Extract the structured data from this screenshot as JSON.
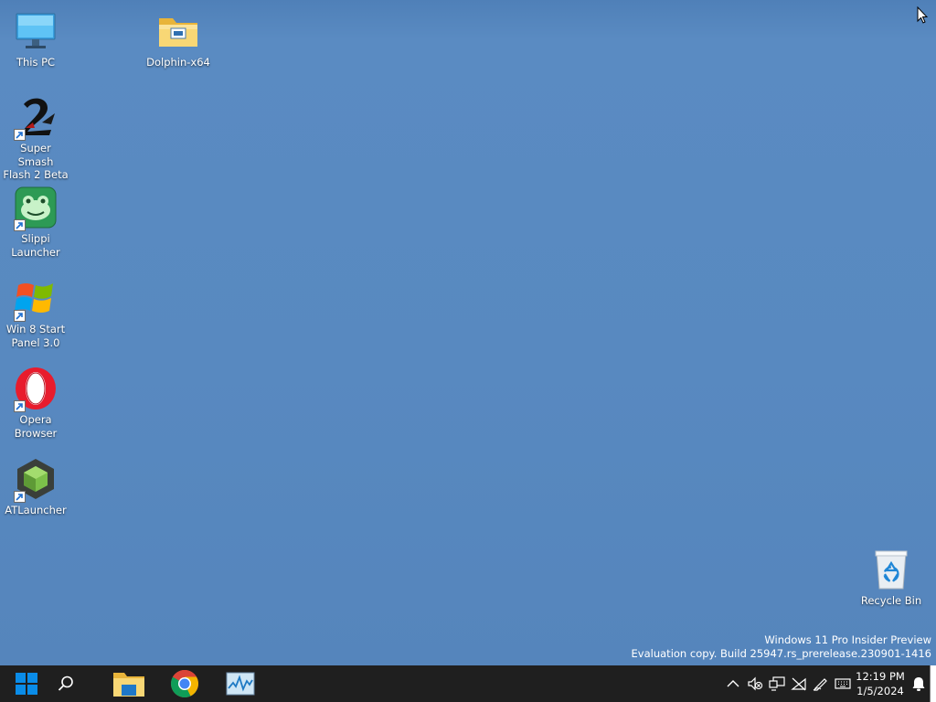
{
  "desktop": {
    "icons": {
      "this_pc": {
        "label": "This PC"
      },
      "dolphin": {
        "label": "Dolphin-x64"
      },
      "ssf2": {
        "label": "Super Smash\nFlash 2 Beta"
      },
      "slippi": {
        "label": "Slippi\nLauncher"
      },
      "win8": {
        "label": "Win 8 Start\nPanel 3.0"
      },
      "opera": {
        "label": "Opera\nBrowser"
      },
      "atlauncher": {
        "label": "ATLauncher"
      },
      "recycle_bin": {
        "label": "Recycle Bin"
      }
    },
    "watermark": {
      "line1": "Windows 11 Pro Insider Preview",
      "line2": "Evaluation copy. Build 25947.rs_prerelease.230901-1416"
    }
  },
  "taskbar": {
    "apps": [
      {
        "icon": "windows-start-icon"
      },
      {
        "icon": "search-icon"
      },
      {
        "icon": "file-explorer-icon"
      },
      {
        "icon": "chrome-icon"
      },
      {
        "icon": "resource-monitor-icon"
      }
    ],
    "tray_icons": [
      "chevron-up-icon",
      "speaker-muted-icon",
      "network-icon",
      "no-wifi-icon",
      "pen-icon",
      "keyboard-icon"
    ],
    "clock": {
      "time": "12:19 PM",
      "date": "1/5/2024"
    }
  },
  "colors": {
    "wallpaper": "#5486bd",
    "taskbar": "#1f1f1f",
    "accent": "#0078d4"
  }
}
